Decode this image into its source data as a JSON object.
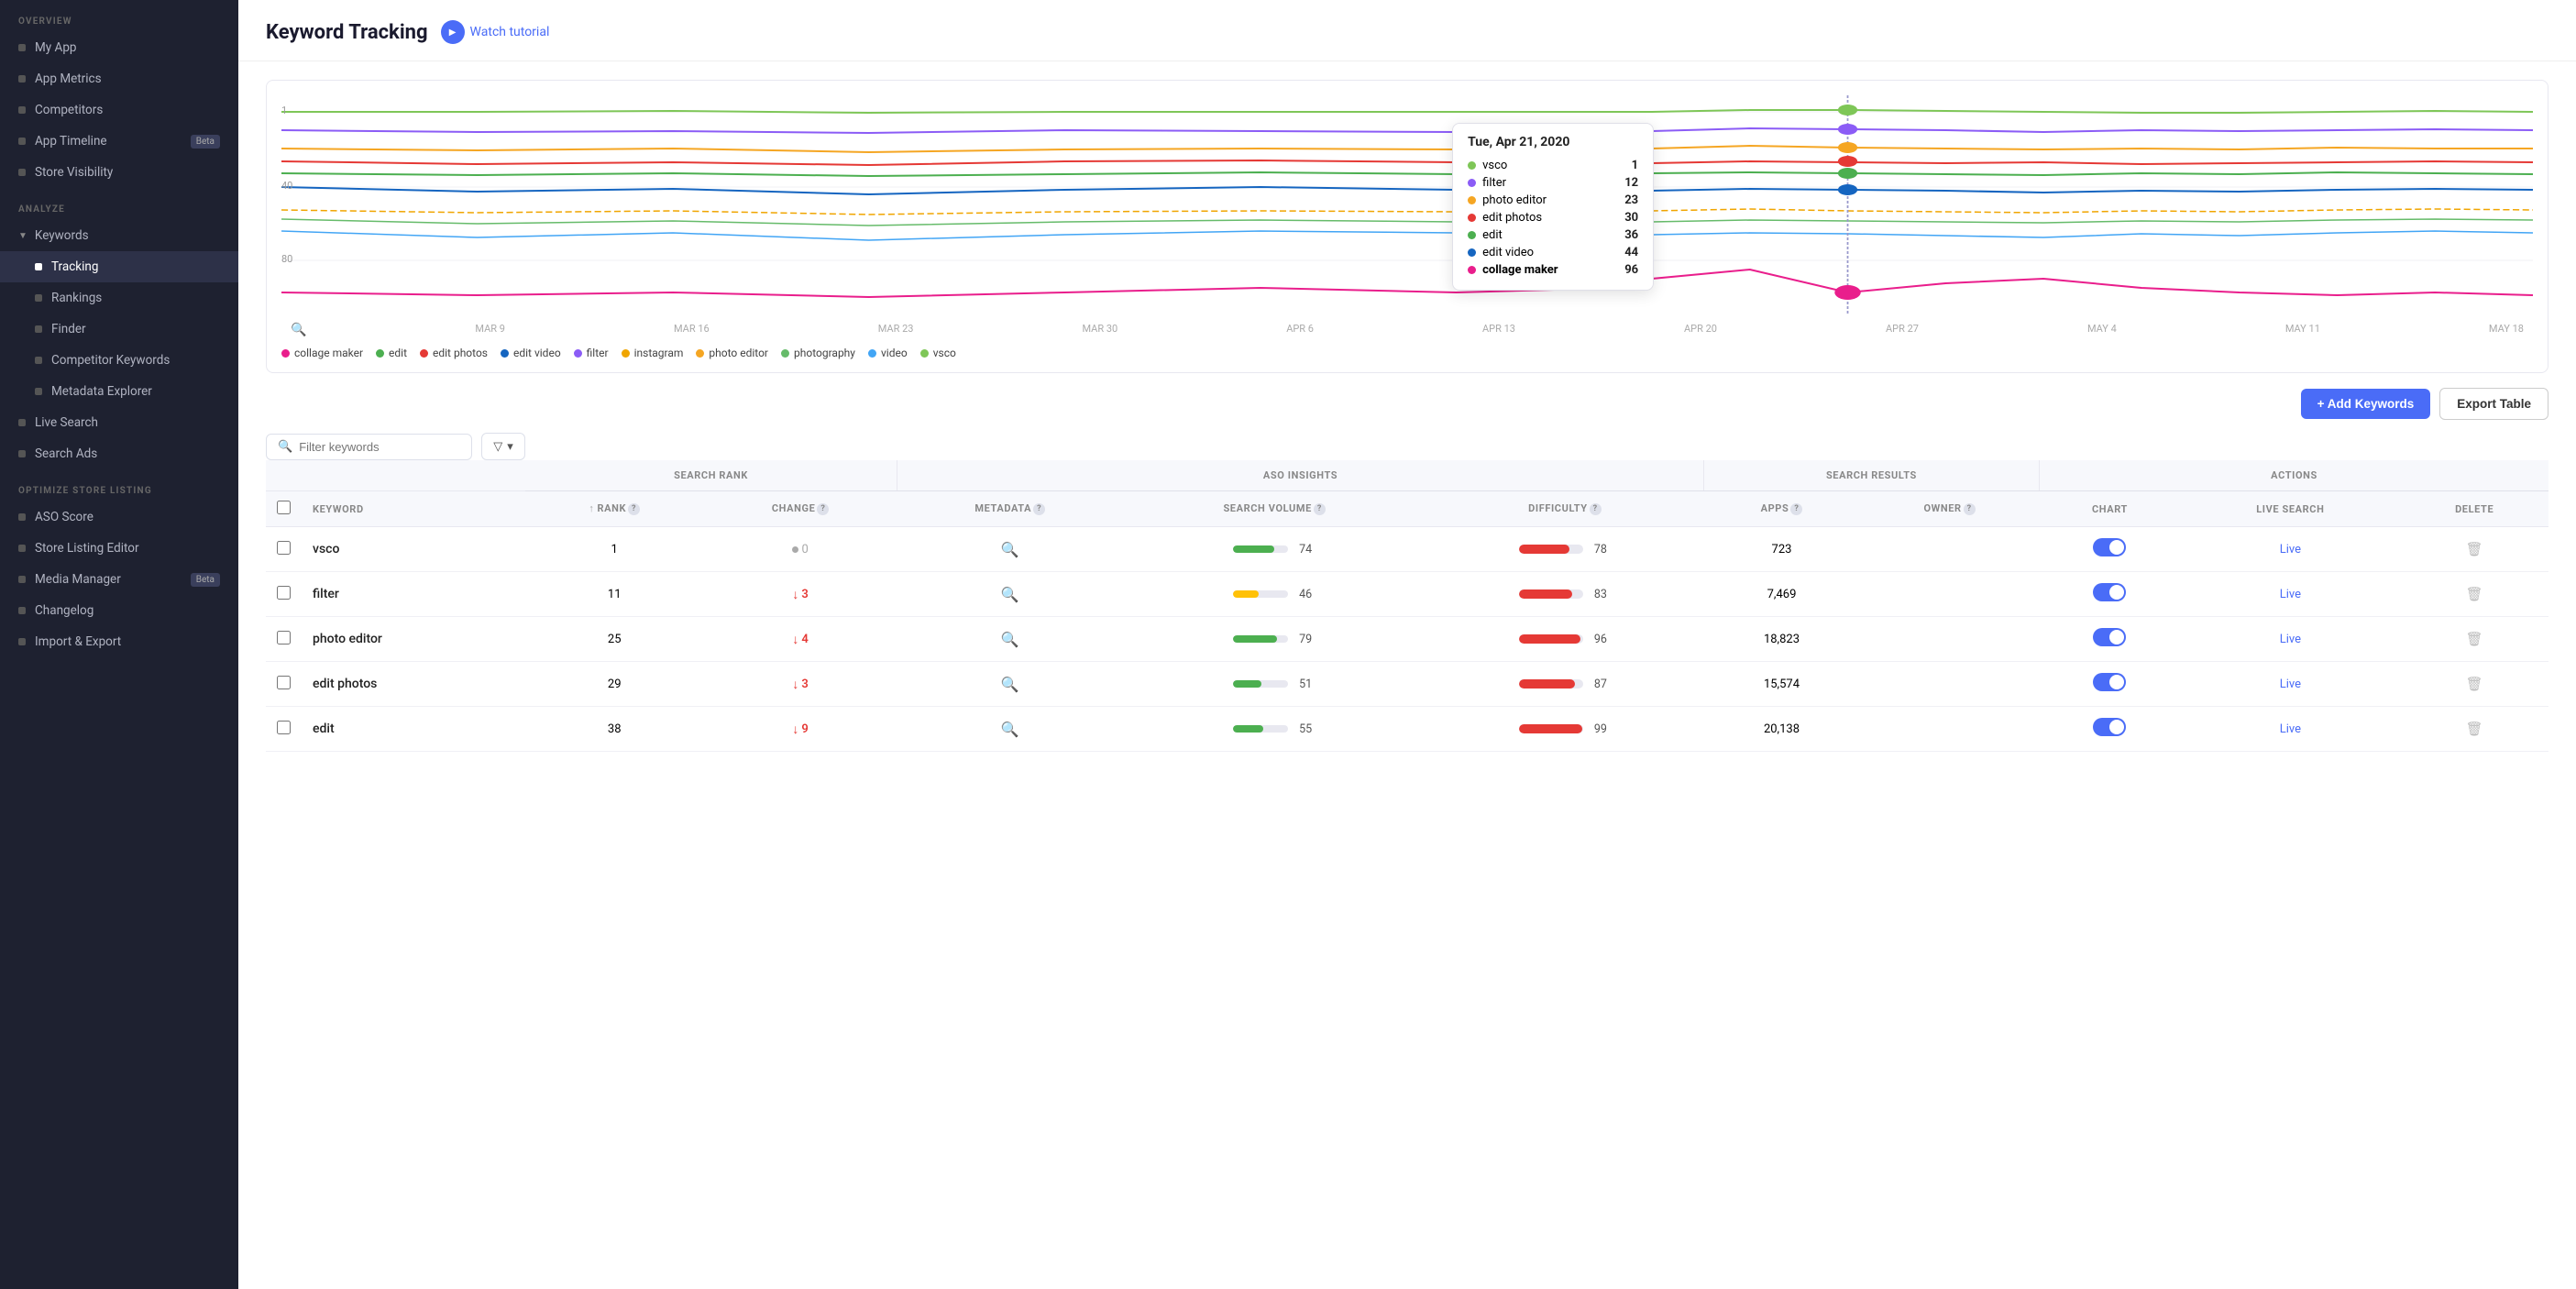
{
  "sidebar": {
    "overview_label": "OVERVIEW",
    "overview_items": [
      {
        "label": "My App",
        "active": false
      },
      {
        "label": "App Metrics",
        "active": false
      },
      {
        "label": "Competitors",
        "active": false
      },
      {
        "label": "App Timeline",
        "active": false,
        "badge": "Beta"
      },
      {
        "label": "Store Visibility",
        "active": false
      }
    ],
    "analyze_label": "ANALYZE",
    "keywords_label": "Keywords",
    "keyword_children": [
      {
        "label": "Tracking",
        "active": true
      },
      {
        "label": "Rankings",
        "active": false
      },
      {
        "label": "Finder",
        "active": false
      },
      {
        "label": "Competitor Keywords",
        "active": false
      },
      {
        "label": "Metadata Explorer",
        "active": false
      }
    ],
    "other_items": [
      {
        "label": "Live Search",
        "active": false
      },
      {
        "label": "Search Ads",
        "active": false
      }
    ],
    "optimize_label": "OPTIMIZE STORE LISTING",
    "optimize_items": [
      {
        "label": "ASO Score",
        "active": false
      },
      {
        "label": "Store Listing Editor",
        "active": false
      },
      {
        "label": "Media Manager",
        "active": false,
        "badge": "Beta"
      },
      {
        "label": "Changelog",
        "active": false
      },
      {
        "label": "Import & Export",
        "active": false
      }
    ]
  },
  "header": {
    "title": "Keyword Tracking",
    "tutorial_label": "Watch tutorial"
  },
  "chart": {
    "tooltip": {
      "date": "Tue, Apr 21, 2020",
      "rows": [
        {
          "color": "#7ec657",
          "label": "vsco",
          "rank": "1",
          "bold": false
        },
        {
          "color": "#8b5cf6",
          "label": "filter",
          "rank": "12",
          "bold": false
        },
        {
          "color": "#f5a623",
          "label": "photo editor",
          "rank": "23",
          "bold": false
        },
        {
          "color": "#e53935",
          "label": "edit photos",
          "rank": "30",
          "bold": false
        },
        {
          "color": "#4caf50",
          "label": "edit",
          "rank": "36",
          "bold": false
        },
        {
          "color": "#1565c0",
          "label": "edit video",
          "rank": "44",
          "bold": false
        },
        {
          "color": "#e91e8c",
          "label": "collage maker",
          "rank": "96",
          "bold": true
        }
      ]
    },
    "legend": [
      {
        "color": "#e91e8c",
        "label": "collage maker"
      },
      {
        "color": "#4caf50",
        "label": "edit"
      },
      {
        "color": "#e53935",
        "label": "edit photos"
      },
      {
        "color": "#1565c0",
        "label": "edit video"
      },
      {
        "color": "#8b5cf6",
        "label": "filter"
      },
      {
        "color": "#f0a500",
        "label": "instagram"
      },
      {
        "color": "#f5a623",
        "label": "photo editor"
      },
      {
        "color": "#66bb6a",
        "label": "photography"
      },
      {
        "color": "#42a5f5",
        "label": "video"
      },
      {
        "color": "#7ec657",
        "label": "vsco"
      }
    ],
    "x_labels": [
      "MAR 9",
      "MAR 16",
      "MAR 23",
      "MAR 30",
      "APR 6",
      "APR 13",
      "APR 20",
      "APR 27",
      "MAY 4",
      "MAY 11",
      "MAY 18"
    ],
    "y_labels": [
      "1",
      "40",
      "80"
    ]
  },
  "toolbar": {
    "add_keywords_label": "+ Add Keywords",
    "export_label": "Export Table"
  },
  "table": {
    "filter_placeholder": "Filter keywords",
    "col_groups": [
      {
        "label": "SEARCH RANK",
        "colspan": 2
      },
      {
        "label": "ASO INSIGHTS",
        "colspan": 3
      },
      {
        "label": "SEARCH RESULTS",
        "colspan": 2
      },
      {
        "label": "ACTIONS",
        "colspan": 3
      }
    ],
    "columns": [
      {
        "label": "KEYWORD",
        "key": "keyword"
      },
      {
        "label": "↑ RANK",
        "key": "rank",
        "info": true
      },
      {
        "label": "CHANGE",
        "key": "change",
        "info": true
      },
      {
        "label": "METADATA",
        "key": "metadata",
        "info": true
      },
      {
        "label": "SEARCH VOLUME",
        "key": "volume",
        "info": true
      },
      {
        "label": "DIFFICULTY",
        "key": "difficulty",
        "info": true
      },
      {
        "label": "APPS",
        "key": "apps",
        "info": true
      },
      {
        "label": "OWNER",
        "key": "owner",
        "info": true
      },
      {
        "label": "CHART",
        "key": "chart"
      },
      {
        "label": "LIVE SEARCH",
        "key": "live_search"
      },
      {
        "label": "DELETE",
        "key": "delete"
      }
    ],
    "rows": [
      {
        "keyword": "vsco",
        "rank": 1,
        "change": 0,
        "change_type": "zero",
        "metadata_icon": true,
        "volume": 74,
        "volume_color": "green",
        "difficulty": 78,
        "difficulty_pct": 78,
        "apps": "723",
        "owner": "",
        "chart_on": true,
        "live": "Live"
      },
      {
        "keyword": "filter",
        "rank": 11,
        "change": 3,
        "change_type": "down",
        "metadata_icon": true,
        "volume": 46,
        "volume_color": "yellow",
        "difficulty": 83,
        "difficulty_pct": 83,
        "apps": "7,469",
        "owner": "",
        "chart_on": true,
        "live": "Live"
      },
      {
        "keyword": "photo editor",
        "rank": 25,
        "change": 4,
        "change_type": "down",
        "metadata_icon": true,
        "volume": 79,
        "volume_color": "green",
        "difficulty": 96,
        "difficulty_pct": 96,
        "apps": "18,823",
        "owner": "",
        "chart_on": true,
        "live": "Live"
      },
      {
        "keyword": "edit photos",
        "rank": 29,
        "change": 3,
        "change_type": "down",
        "metadata_icon": true,
        "volume": 51,
        "volume_color": "green",
        "difficulty": 87,
        "difficulty_pct": 87,
        "apps": "15,574",
        "owner": "",
        "chart_on": true,
        "live": "Live"
      },
      {
        "keyword": "edit",
        "rank": 38,
        "change": 9,
        "change_type": "down",
        "metadata_icon": true,
        "volume": 55,
        "volume_color": "green",
        "difficulty": 99,
        "difficulty_pct": 99,
        "apps": "20,138",
        "owner": "",
        "chart_on": true,
        "live": "Live"
      }
    ]
  }
}
